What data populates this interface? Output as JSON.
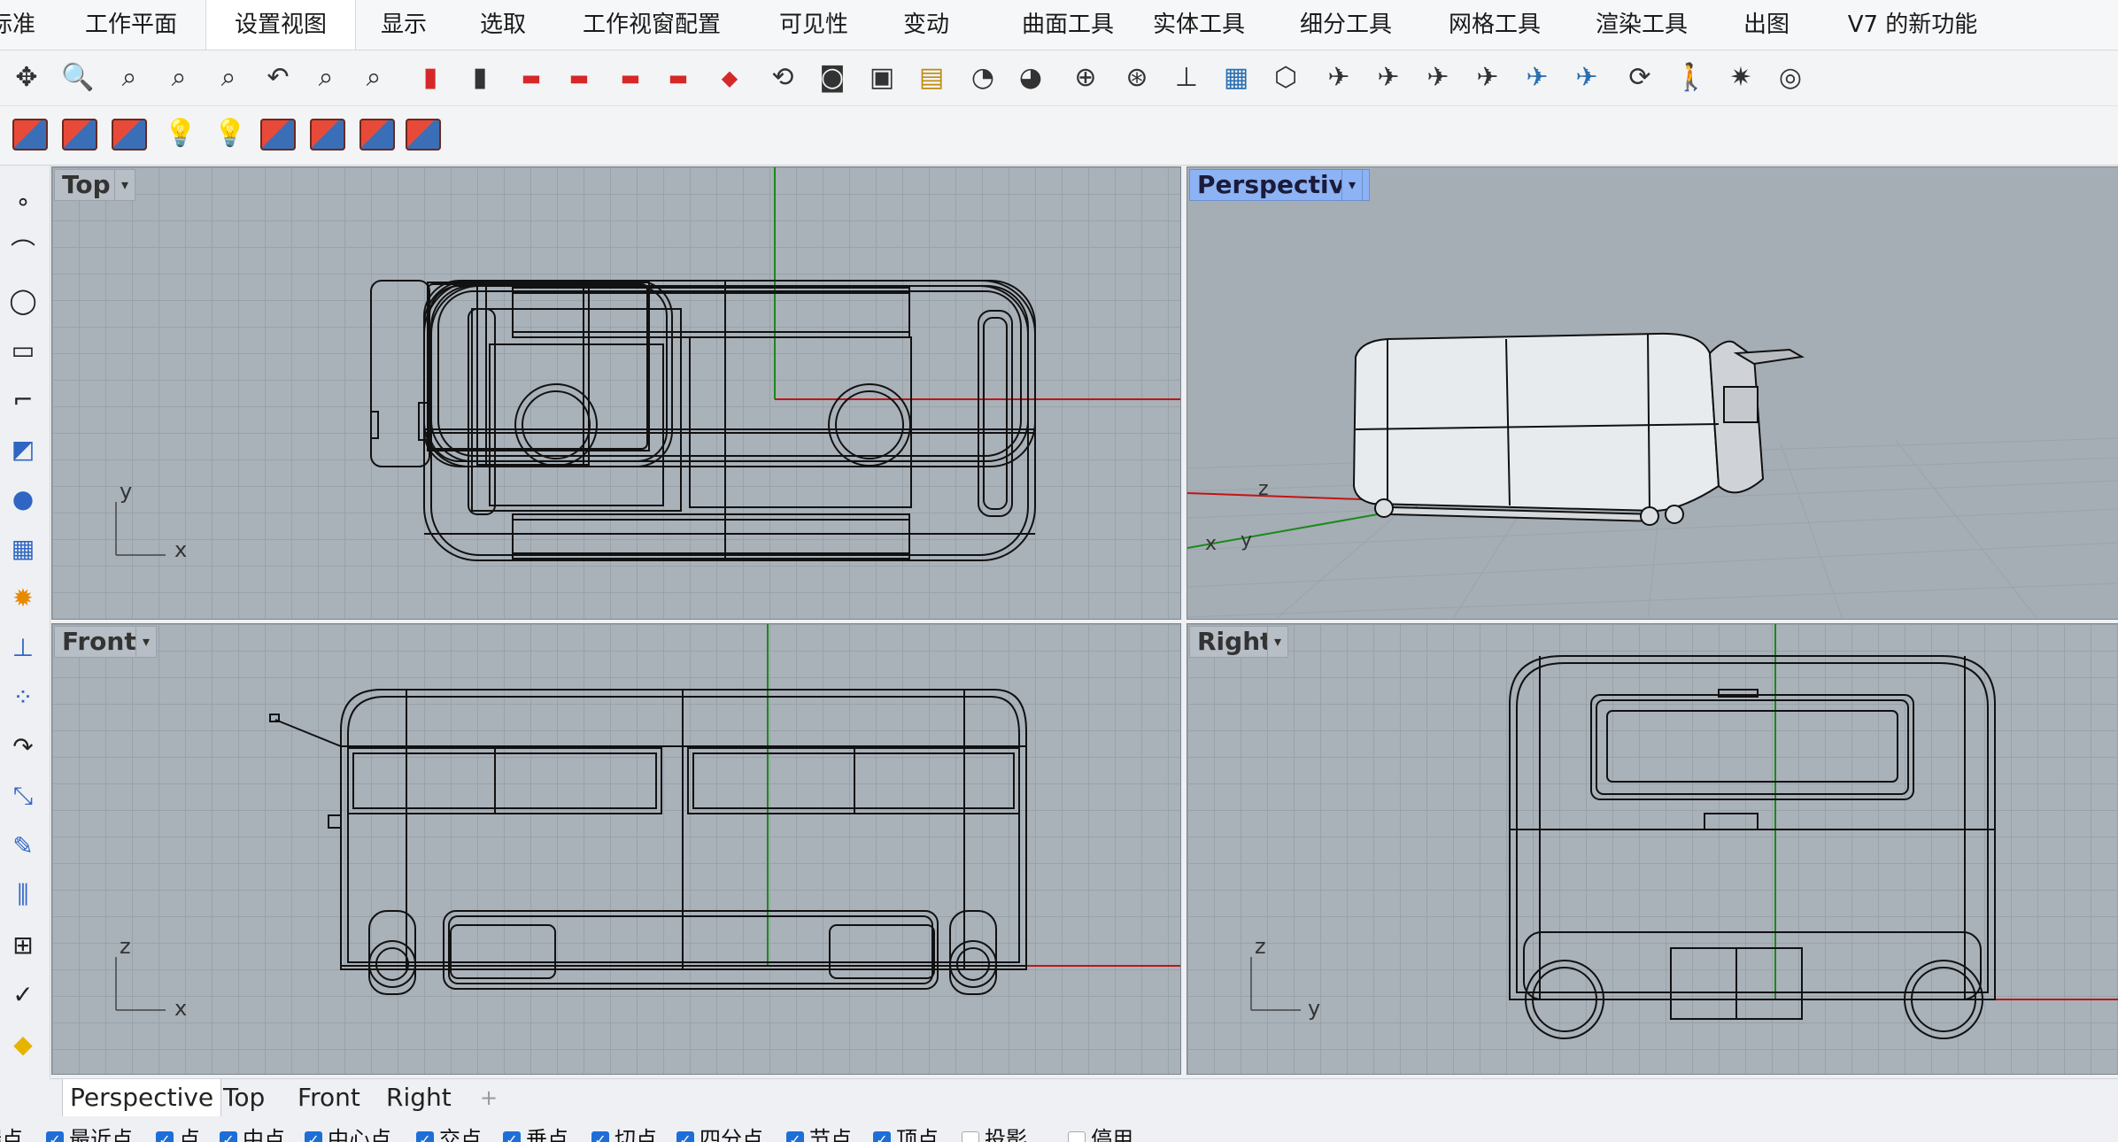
{
  "app_tabs": [
    "标准",
    "工作平面",
    "设置视图",
    "显示",
    "选取",
    "工作视窗配置",
    "可见性",
    "变动",
    "曲面工具",
    "实体工具",
    "细分工具",
    "网格工具",
    "渲染工具",
    "出图",
    "V7 的新功能"
  ],
  "active_tab_index": 2,
  "toolbar_icons": {
    "row1": [
      "pan-icon",
      "zoom-dynamic-icon",
      "zoom-extents-icon",
      "zoom-window-icon",
      "zoom-selected-icon",
      "undo-view-icon",
      "zoom-out-icon",
      "zoom-in-icon",
      "red-cabinet-icon",
      "dark-cabinet-icon",
      "car-front-icon",
      "car-side-icon",
      "car-side-2-icon",
      "car-back-icon",
      "car-angle-icon",
      "camera-rotate-icon",
      "camera-icon",
      "save-view-icon",
      "restore-view-icon",
      "light-icon",
      "lights-icon",
      "target-icon",
      "target-2-icon",
      "set-cplane-icon",
      "texture-camera-icon",
      "box-view-icon",
      "plane-top-icon",
      "plane-front-icon",
      "plane-side-icon",
      "plane-side-2-icon",
      "plane-flat-icon",
      "plane-flat-2-icon",
      "rotate-360-icon",
      "walkabout-icon",
      "sun-icon",
      "compass-icon"
    ],
    "row2": [
      "named-view-icon",
      "named-view-2-icon",
      "named-view-3-icon",
      "bulb-icon",
      "bulb-2-icon",
      "named-view-4-icon",
      "named-view-5-icon",
      "named-view-6-icon",
      "named-view-7-icon"
    ]
  },
  "left_tools": [
    "point-icon",
    "polyline-icon",
    "circle-icon",
    "rectangle-icon",
    "curve-icon",
    "surface-icon",
    "solid-icon",
    "mesh-icon",
    "explode-icon",
    "dimension-icon",
    "array-icon",
    "fillet-icon",
    "transform-icon",
    "edit-icon",
    "analyze-icon",
    "grid-icon",
    "check-icon",
    "render-icon"
  ],
  "viewports": {
    "top": {
      "label": "Top",
      "axis_x": "x",
      "axis_y": "y"
    },
    "perspective": {
      "label": "Perspective",
      "axis_x": "x",
      "axis_y": "y",
      "axis_z": "z"
    },
    "front": {
      "label": "Front",
      "axis_x": "x",
      "axis_z": "z"
    },
    "right": {
      "label": "Right",
      "axis_y": "y",
      "axis_z": "z"
    }
  },
  "viewport_dropdown_glyph": "▾",
  "bottom_tabs": [
    "Perspective",
    "Top",
    "Front",
    "Right"
  ],
  "bottom_tab_add": "+",
  "osnaps": [
    {
      "label": "端点",
      "checked": true
    },
    {
      "label": "最近点",
      "checked": true
    },
    {
      "label": "点",
      "checked": true
    },
    {
      "label": "中点",
      "checked": true
    },
    {
      "label": "中心点",
      "checked": true
    },
    {
      "label": "交点",
      "checked": true
    },
    {
      "label": "垂点",
      "checked": true
    },
    {
      "label": "切点",
      "checked": true
    },
    {
      "label": "四分点",
      "checked": true
    },
    {
      "label": "节点",
      "checked": true
    },
    {
      "label": "顶点",
      "checked": true
    },
    {
      "label": "投影",
      "checked": false
    },
    {
      "label": "停用",
      "checked": false
    }
  ],
  "colors": {
    "viewport_bg": "#a9b1b9",
    "grid_line": "#99a1a9",
    "active_label": "#8db3f5",
    "axis_x": "#c01515",
    "axis_y": "#1a8a1a",
    "wire": "#111111",
    "checkbox": "#1e6ed8"
  }
}
